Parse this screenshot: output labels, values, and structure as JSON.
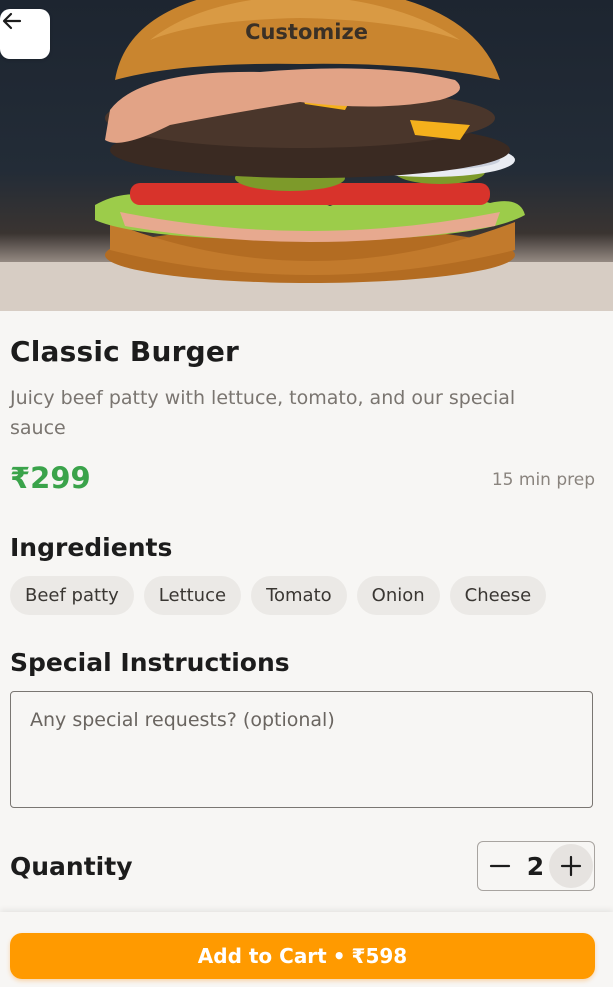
{
  "header": {
    "title": "Customize",
    "back_icon": "arrow-left-icon",
    "hero_image": "burger-photo"
  },
  "product": {
    "name": "Classic Burger",
    "description": "Juicy beef patty with lettuce, tomato, and our special sauce",
    "price": "₹299",
    "prep_time": "15 min prep"
  },
  "ingredients": {
    "title": "Ingredients",
    "items": [
      "Beef patty",
      "Lettuce",
      "Tomato",
      "Onion",
      "Cheese"
    ]
  },
  "instructions": {
    "title": "Special Instructions",
    "placeholder": "Any special requests? (optional)",
    "value": ""
  },
  "quantity": {
    "title": "Quantity",
    "value": "2",
    "minus_icon": "minus-icon",
    "plus_icon": "plus-icon"
  },
  "cart": {
    "label": "Add to Cart",
    "separator": "•",
    "total": "₹598"
  },
  "colors": {
    "accent": "#ff9a00",
    "price": "#3aa34a",
    "background": "#f7f6f4",
    "chip": "#ebe9e6"
  }
}
